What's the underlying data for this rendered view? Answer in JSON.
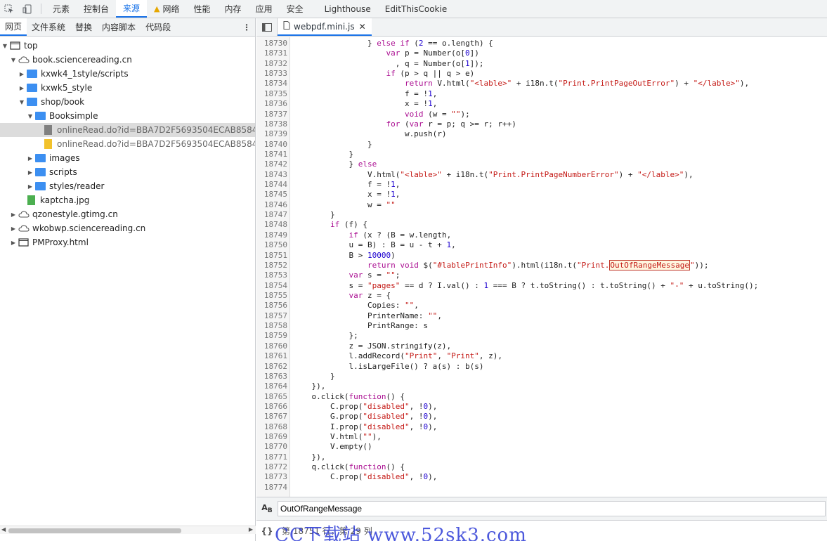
{
  "toolbar": {
    "tabs": [
      "元素",
      "控制台",
      "来源",
      "网络",
      "性能",
      "内存",
      "应用",
      "安全",
      "Lighthouse",
      "EditThisCookie"
    ],
    "active": "来源"
  },
  "navigator": {
    "tabs": [
      "网页",
      "文件系统",
      "替换",
      "内容脚本",
      "代码段"
    ],
    "tree": [
      {
        "label": "top"
      },
      {
        "label": "book.sciencereading.cn"
      },
      {
        "label": "kxwk4_1style/scripts"
      },
      {
        "label": "kxwk5_style"
      },
      {
        "label": "shop/book"
      },
      {
        "label": "Booksimple"
      },
      {
        "label": "onlineRead.do?id=BBA7D2F5693504ECAB85843A6BE"
      },
      {
        "label": "onlineRead.do?id=BBA7D2F5693504ECAB85843A6BE"
      },
      {
        "label": "images"
      },
      {
        "label": "scripts"
      },
      {
        "label": "styles/reader"
      },
      {
        "label": "kaptcha.jpg"
      },
      {
        "label": "qzonestyle.gtimg.cn"
      },
      {
        "label": "wkobwp.sciencereading.cn"
      },
      {
        "label": "PMProxy.html"
      }
    ]
  },
  "editor": {
    "tab_label": "webpdf.mini.js",
    "lines": [
      {
        "n": "18730",
        "t": "                } else if (2 == o.length) {"
      },
      {
        "n": "18731",
        "t": "                    var p = Number(o[0])"
      },
      {
        "n": "18732",
        "t": "                      , q = Number(o[1]);"
      },
      {
        "n": "18733",
        "t": "                    if (p > q || q > e)"
      },
      {
        "n": "18734",
        "t": "                        return V.html(\"<lable>\" + i18n.t(\"Print.PrintPageOutError\") + \"</lable>\"),"
      },
      {
        "n": "18735",
        "t": "                        f = !1,"
      },
      {
        "n": "18736",
        "t": "                        x = !1,"
      },
      {
        "n": "18737",
        "t": "                        void (w = \"\");"
      },
      {
        "n": "18738",
        "t": "                    for (var r = p; q >= r; r++)"
      },
      {
        "n": "18739",
        "t": "                        w.push(r)"
      },
      {
        "n": "18740",
        "t": "                }"
      },
      {
        "n": "18741",
        "t": "            }"
      },
      {
        "n": "18742",
        "t": "            } else"
      },
      {
        "n": "18743",
        "t": "                V.html(\"<lable>\" + i18n.t(\"Print.PrintPageNumberError\") + \"</lable>\"),"
      },
      {
        "n": "18744",
        "t": "                f = !1,"
      },
      {
        "n": "18745",
        "t": "                x = !1,"
      },
      {
        "n": "18746",
        "t": "                w = \"\""
      },
      {
        "n": "18747",
        "t": "        }"
      },
      {
        "n": "18748",
        "t": "        if (f) {"
      },
      {
        "n": "18749",
        "t": "            if (x ? (B = w.length,"
      },
      {
        "n": "18750",
        "t": "            u = B) : B = u - t + 1,"
      },
      {
        "n": "18751",
        "t": "            B > 10000)"
      },
      {
        "n": "18752",
        "t": "                return void $(\"#lablePrintInfo\").html(i18n.t(\"Print.OutOfRangeMessage\"));"
      },
      {
        "n": "18753",
        "t": "            var s = \"\";"
      },
      {
        "n": "18754",
        "t": "            s = \"pages\" == d ? I.val() : 1 === B ? t.toString() : t.toString() + \"-\" + u.toString();"
      },
      {
        "n": "18755",
        "t": "            var z = {"
      },
      {
        "n": "18756",
        "t": "                Copies: \"\","
      },
      {
        "n": "18757",
        "t": "                PrinterName: \"\","
      },
      {
        "n": "18758",
        "t": "                PrintRange: s"
      },
      {
        "n": "18759",
        "t": "            };"
      },
      {
        "n": "18760",
        "t": "            z = JSON.stringify(z),"
      },
      {
        "n": "18761",
        "t": "            l.addRecord(\"Print\", \"Print\", z),"
      },
      {
        "n": "18762",
        "t": "            l.isLargeFile() ? a(s) : b(s)"
      },
      {
        "n": "18763",
        "t": "        }"
      },
      {
        "n": "18764",
        "t": "    }),"
      },
      {
        "n": "18765",
        "t": "    o.click(function() {"
      },
      {
        "n": "18766",
        "t": "        C.prop(\"disabled\", !0),"
      },
      {
        "n": "18767",
        "t": "        G.prop(\"disabled\", !0),"
      },
      {
        "n": "18768",
        "t": "        I.prop(\"disabled\", !0),"
      },
      {
        "n": "18769",
        "t": "        V.html(\"\"),"
      },
      {
        "n": "18770",
        "t": "        V.empty()"
      },
      {
        "n": "18771",
        "t": "    }),"
      },
      {
        "n": "18772",
        "t": "    q.click(function() {"
      },
      {
        "n": "18773",
        "t": "        C.prop(\"disabled\", !0),"
      },
      {
        "n": "18774",
        "t": ""
      }
    ]
  },
  "search": {
    "value": "OutOfRangeMessage"
  },
  "status": {
    "position": "第 18751 行，第 29 列"
  },
  "watermark": "CC下载站  www.52sk3.com"
}
